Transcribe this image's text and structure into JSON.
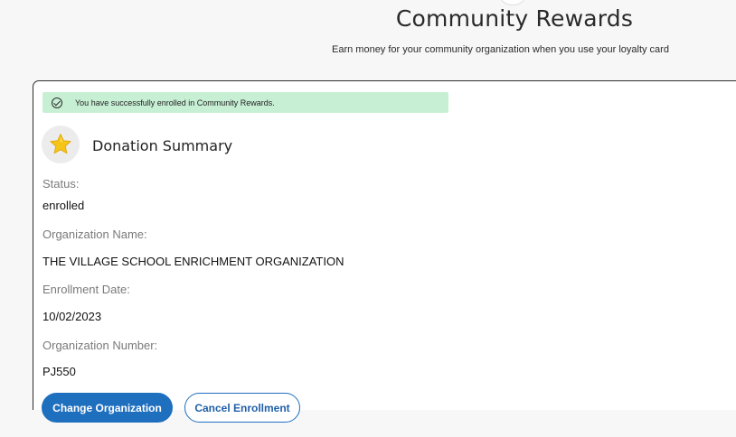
{
  "header": {
    "title": "Community Rewards",
    "subtitle": "Earn money for your community organization when you use your loyalty card"
  },
  "banner": {
    "icon": "check-circle-icon",
    "text": "You have successfully enrolled in Community Rewards."
  },
  "summary": {
    "icon": "star-icon",
    "title": "Donation Summary",
    "fields": [
      {
        "label": "Status:",
        "value": "enrolled"
      },
      {
        "label": "Organization Name:",
        "value": "THE VILLAGE SCHOOL ENRICHMENT ORGANIZATION"
      },
      {
        "label": "Enrollment Date:",
        "value": "10/02/2023"
      },
      {
        "label": "Organization Number:",
        "value": "PJ550"
      }
    ]
  },
  "actions": {
    "change_label": "Change Organization",
    "cancel_label": "Cancel Enrollment"
  },
  "colors": {
    "primary": "#1f6fbf",
    "success_bg": "#c7efd4",
    "star": "#f5c518"
  }
}
